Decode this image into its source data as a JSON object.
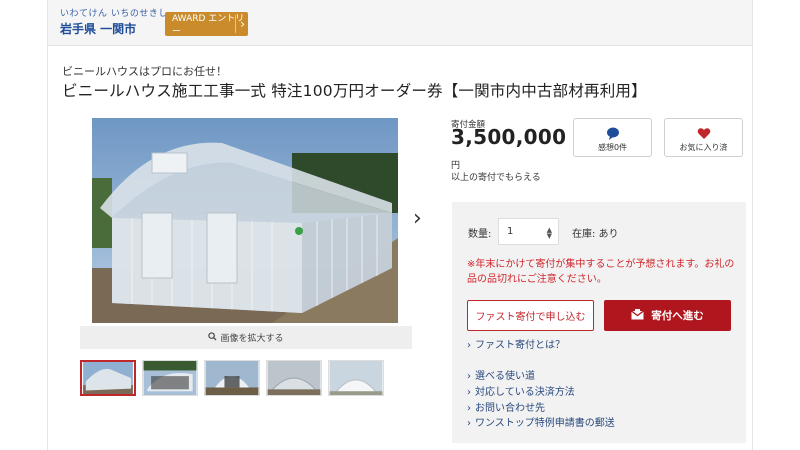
{
  "header": {
    "municipality_kana": "いわてけん いちのせきし",
    "municipality_name": "岩手県 一関市",
    "award_label": "AWARD エントリー"
  },
  "product": {
    "catch_copy": "ビニールハウスはプロにお任せ！",
    "title": "ビニールハウス施工工事一式 特注100万円オーダー券【一関市内中古部材再利用】",
    "zoom_label": "画像を拡大する",
    "thumbnail_count": 5,
    "active_thumbnail": 1
  },
  "price": {
    "label": "寄付金額",
    "amount": "3,500,000",
    "unit": "円",
    "note": "以上の寄付でもらえる"
  },
  "buttons": {
    "thanks_label": "感想0件",
    "favorite_label": "お気に入り済"
  },
  "order": {
    "quantity_label": "数量:",
    "quantity_value": "1",
    "stock_text": "在庫: あり",
    "warning": "※年末にかけて寄付が集中することが予想されます。お礼の品の品切れにご注意ください。",
    "fast_button": "ファスト寄付で申し込む",
    "donate_button": "寄付へ進む"
  },
  "links": [
    "ファスト寄付とは？",
    "選べる使い道",
    "対応している決済方法",
    "お問い合わせ先",
    "ワンストップ特例申請書の郵送"
  ],
  "colors": {
    "accent_red": "#b0161d",
    "award_gold": "#c98b2c",
    "link_blue": "#2a4a7f",
    "municipality_blue": "#1f4d9a"
  },
  "icons": {
    "thanks": "speech-bubble-icon",
    "favorite": "heart-icon",
    "zoom": "magnifier-icon",
    "donate": "envelope-icon",
    "next": "chevron-right-icon"
  }
}
